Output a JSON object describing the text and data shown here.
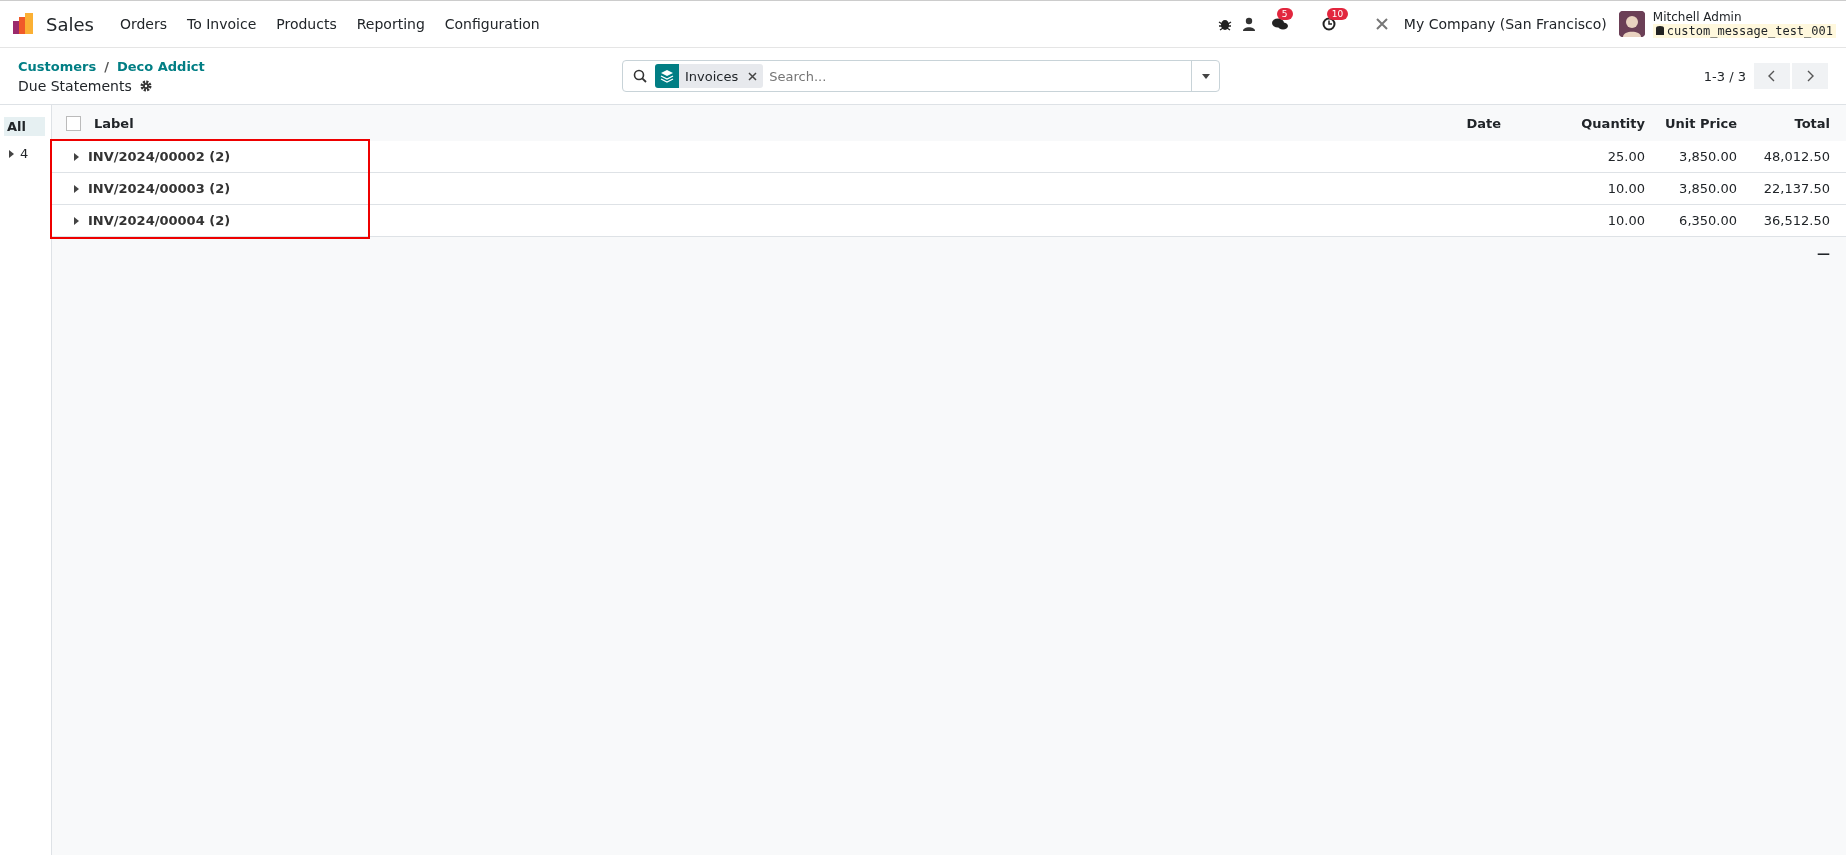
{
  "navbar": {
    "app": "Sales",
    "menu": [
      "Orders",
      "To Invoice",
      "Products",
      "Reporting",
      "Configuration"
    ],
    "chat_count": "5",
    "activity_count": "10",
    "company": "My Company (San Francisco)",
    "user": "Mitchell Admin",
    "database": "custom_message_test_001"
  },
  "breadcrumbs": [
    "Customers",
    "Deco Addict"
  ],
  "breadcrumb_separator": "/",
  "title": "Due Statements",
  "search": {
    "facet": "Invoices",
    "placeholder": "Search..."
  },
  "pager": "1-3 / 3",
  "side_panel": [
    {
      "label": "All",
      "selected": true
    },
    {
      "label": "4",
      "selected": false,
      "expanded": false
    }
  ],
  "table": {
    "select_all_checked": false,
    "columns": [
      "Label",
      "Date",
      "Quantity",
      "Unit Price",
      "Total"
    ],
    "rows": [
      {
        "label": "INV/2024/00002 (2)",
        "expanded": false,
        "quantity": "25.00",
        "unit_price": "3,850.00",
        "total": "48,012.50"
      },
      {
        "label": "INV/2024/00003 (2)",
        "expanded": false,
        "quantity": "10.00",
        "unit_price": "3,850.00",
        "total": "22,137.50"
      },
      {
        "label": "INV/2024/00004 (2)",
        "expanded": false,
        "quantity": "10.00",
        "unit_price": "6,350.00",
        "total": "36,512.50"
      }
    ],
    "footer_total": "—"
  }
}
